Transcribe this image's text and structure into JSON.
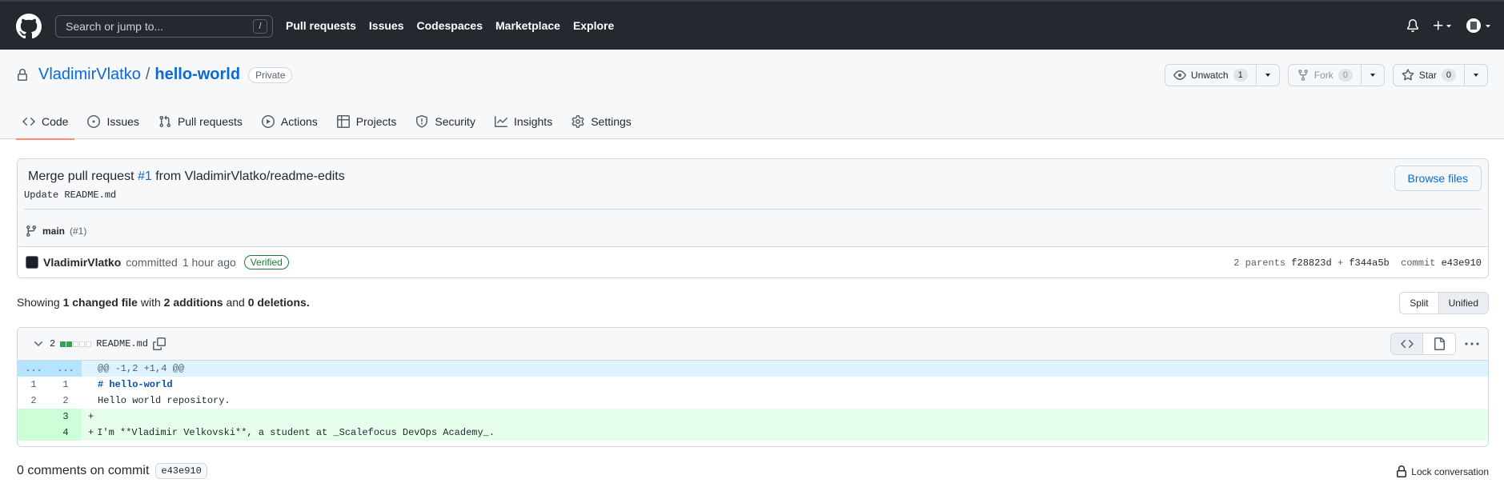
{
  "header": {
    "search_placeholder": "Search or jump to...",
    "search_shortcut": "/",
    "nav": [
      "Pull requests",
      "Issues",
      "Codespaces",
      "Marketplace",
      "Explore"
    ]
  },
  "repo": {
    "owner": "VladimirVlatko",
    "separator": "/",
    "name": "hello-world",
    "visibility": "Private",
    "watch_label": "Unwatch",
    "watch_count": "1",
    "fork_label": "Fork",
    "fork_count": "0",
    "star_label": "Star",
    "star_count": "0"
  },
  "tabs": [
    "Code",
    "Issues",
    "Pull requests",
    "Actions",
    "Projects",
    "Security",
    "Insights",
    "Settings"
  ],
  "commit": {
    "title_prefix": "Merge pull request",
    "pr_link": "#1",
    "title_suffix": "from VladimirVlatko/readme-edits",
    "description": "Update README.md",
    "branch": "main",
    "branch_pr": "(#1)",
    "browse_label": "Browse files",
    "author": "VladimirVlatko",
    "action": "committed",
    "time": "1 hour ago",
    "verified": "Verified",
    "parents_label": "2 parents",
    "parent1": "f28823d",
    "parent_plus": "+",
    "parent2": "f344a5b",
    "commit_label": "commit",
    "commit_sha": "e43e910"
  },
  "summary": {
    "showing": "Showing",
    "changed": "1 changed file",
    "with": "with",
    "additions": "2 additions",
    "and": "and",
    "deletions": "0 deletions."
  },
  "view_toggle": {
    "split": "Split",
    "unified": "Unified"
  },
  "file": {
    "changes": "2",
    "name": "README.md",
    "hunk": {
      "left": "...",
      "right": "...",
      "text": "@@ -1,2 +1,4 @@"
    },
    "lines": [
      {
        "old": "1",
        "new": "1",
        "prefix": "",
        "text": "# hello-world",
        "type": "ctx"
      },
      {
        "old": "2",
        "new": "2",
        "prefix": "",
        "text": "Hello world repository.",
        "type": "ctx"
      },
      {
        "old": "",
        "new": "3",
        "prefix": "+",
        "text": "",
        "type": "add"
      },
      {
        "old": "",
        "new": "4",
        "prefix": "+",
        "text": "I'm **Vladimir Velkovski**, a student at _Scalefocus DevOps Academy_.",
        "type": "add"
      }
    ]
  },
  "comments": {
    "heading": "0 comments on commit",
    "sha": "e43e910",
    "lock_label": "Lock conversation"
  },
  "colors": {
    "header_bg": "#24292f",
    "link": "#0969da",
    "tab_underline": "#fd8c73",
    "added_bg": "#e6ffec",
    "hunk_bg": "#ddf4ff",
    "verified": "#1a7f37"
  }
}
